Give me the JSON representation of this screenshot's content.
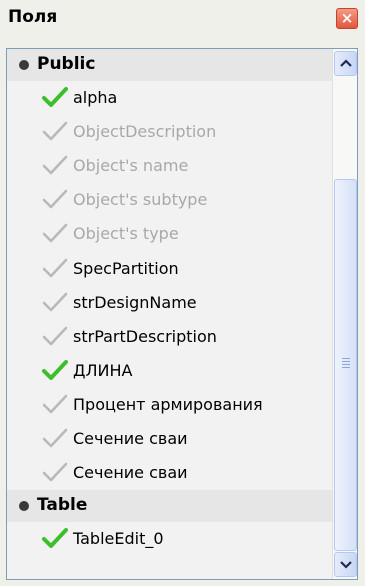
{
  "panel": {
    "title": "Поля",
    "close_label": "×"
  },
  "groups": [
    {
      "label": "Public",
      "items": [
        {
          "label": "alpha",
          "enabled": true,
          "checked": true
        },
        {
          "label": "ObjectDescription",
          "enabled": false,
          "checked": false
        },
        {
          "label": "Object's name",
          "enabled": false,
          "checked": false
        },
        {
          "label": "Object's subtype",
          "enabled": false,
          "checked": false
        },
        {
          "label": "Object's type",
          "enabled": false,
          "checked": false
        },
        {
          "label": "SpecPartition",
          "enabled": true,
          "checked": false
        },
        {
          "label": "strDesignName",
          "enabled": true,
          "checked": false
        },
        {
          "label": "strPartDescription",
          "enabled": true,
          "checked": false
        },
        {
          "label": "ДЛИНА",
          "enabled": true,
          "checked": true
        },
        {
          "label": "Процент армирования",
          "enabled": true,
          "checked": false
        },
        {
          "label": "Сечение сваи",
          "enabled": true,
          "checked": false
        },
        {
          "label": "Сечение сваи",
          "enabled": true,
          "checked": false
        }
      ]
    },
    {
      "label": "Table",
      "items": [
        {
          "label": "TableEdit_0",
          "enabled": true,
          "checked": true
        }
      ]
    }
  ],
  "icons": {
    "close": "close-icon",
    "group_bullet": "bullet-icon",
    "check": "checkmark-icon",
    "scroll_up": "chevron-up-icon",
    "scroll_down": "chevron-down-icon",
    "grip": "grip-icon"
  },
  "colors": {
    "check_active": "#3bbf2b",
    "check_inactive": "#b9b9b9",
    "text_disabled": "#a8a8a8",
    "close_button": "#e2583e",
    "group_header_bg": "#e6e6e6",
    "list_bg": "#f2f2f2"
  }
}
